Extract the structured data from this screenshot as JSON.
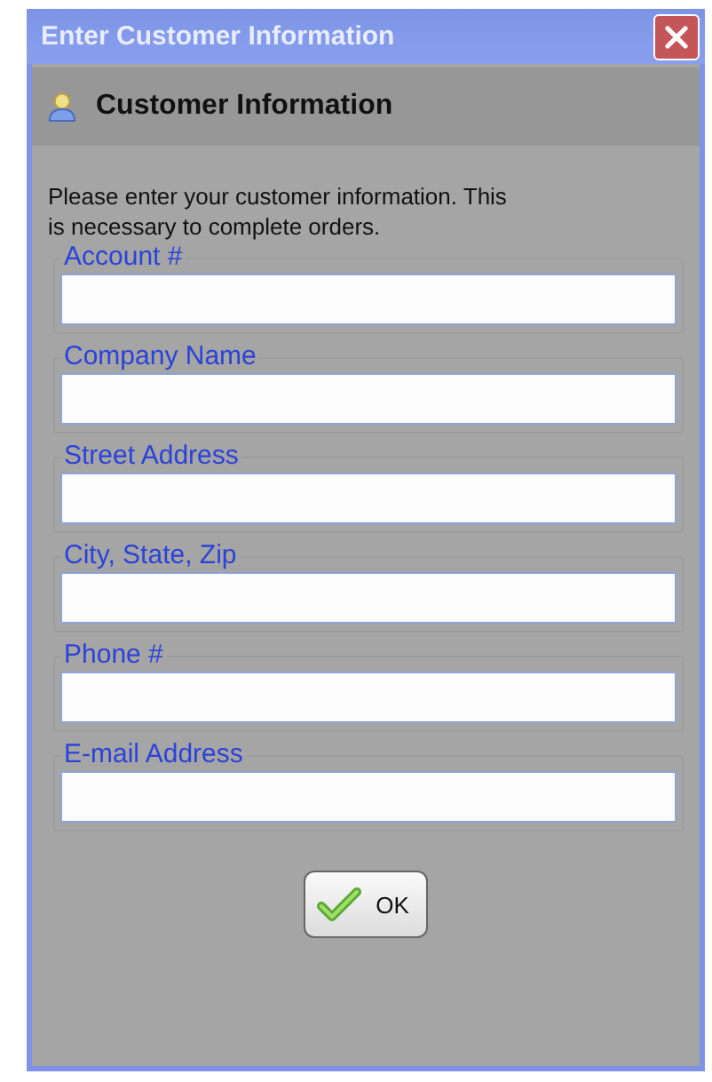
{
  "window": {
    "title": "Enter Customer Information"
  },
  "header": {
    "title": "Customer Information"
  },
  "instructions": "Please enter your customer information. This\nis necessary to complete orders.",
  "fields": [
    {
      "label": "Account #"
    },
    {
      "label": "Company Name"
    },
    {
      "label": "Street Address"
    },
    {
      "label": "City, State, Zip"
    },
    {
      "label": "Phone #"
    },
    {
      "label": "E-mail Address"
    }
  ],
  "buttons": [
    {
      "label": "OK"
    }
  ]
}
